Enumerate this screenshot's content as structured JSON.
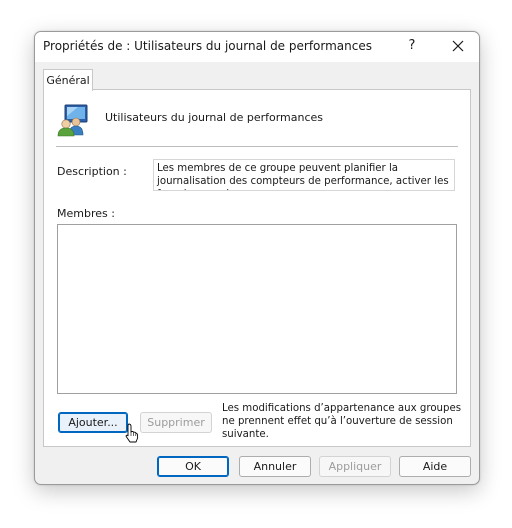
{
  "window": {
    "title": "Propriétés de : Utilisateurs du journal de performances",
    "help_glyph": "?",
    "close_icon": "close-icon"
  },
  "tabs": [
    {
      "label": "Général",
      "selected": true
    }
  ],
  "general": {
    "group_icon": "users-group-icon",
    "group_name": "Utilisateurs du journal de performances",
    "description_label": "Description :",
    "description_text": "Les membres de ce groupe peuvent planifier la journalisation des compteurs de performance, activer les fournisseurs de",
    "members_label": "Membres :",
    "members": [],
    "add_label": "Ajouter...",
    "remove_label": "Supprimer",
    "note": "Les modifications d’appartenance aux groupes ne prennent effet qu’à l’ouverture de session suivante."
  },
  "footer": {
    "ok_label": "OK",
    "cancel_label": "Annuler",
    "apply_label": "Appliquer",
    "help_label": "Aide"
  },
  "colors": {
    "accent": "#0067c0",
    "dialog_bg": "#f0f0f0",
    "panel_bg": "#ffffff"
  }
}
